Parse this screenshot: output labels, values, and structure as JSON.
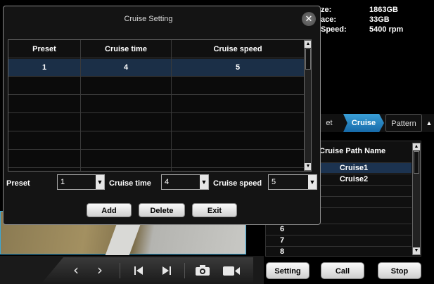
{
  "dialog": {
    "title": "Cruise Setting",
    "close_glyph": "✕",
    "columns": [
      "Preset",
      "Cruise time",
      "Cruise speed"
    ],
    "rows": [
      {
        "preset": "1",
        "time": "4",
        "speed": "5"
      }
    ],
    "form": {
      "preset_label": "Preset",
      "preset_value": "1",
      "time_label": "Cruise time",
      "time_value": "4",
      "speed_label": "Cruise speed",
      "speed_value": "5"
    },
    "buttons": {
      "add": "Add",
      "delete": "Delete",
      "exit": "Exit"
    }
  },
  "disk_info": [
    {
      "label": "ze:",
      "value": "1863GB"
    },
    {
      "label": "ace:",
      "value": "33GB"
    },
    {
      "label": "Speed:",
      "value": "5400 rpm"
    }
  ],
  "tabs": {
    "left_partial": "et",
    "active": "Cruise",
    "pattern": "Pattern"
  },
  "cruise_list": {
    "header": "Cruise Path Name",
    "rows": [
      {
        "num": "",
        "name": "Cruise1"
      },
      {
        "num": "",
        "name": "Cruise2"
      },
      {
        "num": "",
        "name": ""
      },
      {
        "num": "",
        "name": ""
      },
      {
        "num": "",
        "name": ""
      },
      {
        "num": "6",
        "name": ""
      },
      {
        "num": "7",
        "name": ""
      },
      {
        "num": "8",
        "name": ""
      }
    ]
  },
  "actions": {
    "setting": "Setting",
    "call": "Call",
    "stop": "Stop"
  },
  "playback_icons": [
    "chevron-left-icon",
    "chevron-right-icon",
    "skip-back-icon",
    "skip-forward-icon",
    "camera-icon",
    "video-camera-icon"
  ],
  "colors": {
    "accent": "#1669a8",
    "selected_row": "#1b2f47"
  }
}
